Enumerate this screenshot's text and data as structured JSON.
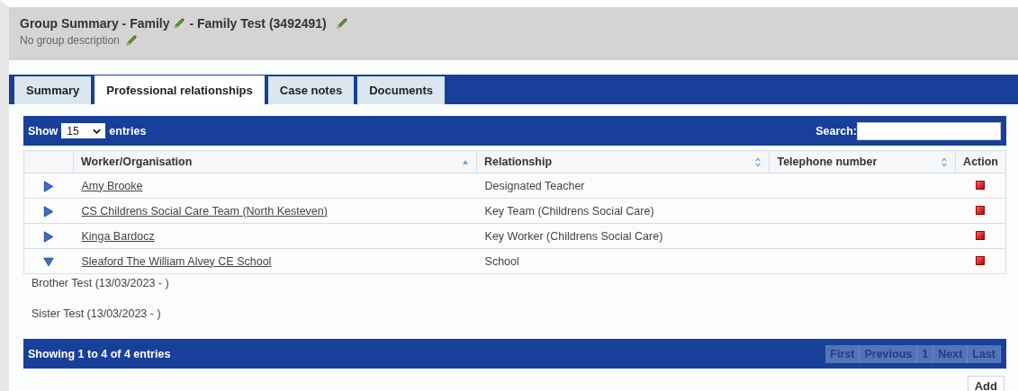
{
  "header": {
    "title_prefix": "Group Summary - Family",
    "title_suffix": "- Family Test (3492491)",
    "description": "No group description"
  },
  "tabs": [
    {
      "label": "Summary",
      "selected": false
    },
    {
      "label": "Professional relationships",
      "selected": true
    },
    {
      "label": "Case notes",
      "selected": false
    },
    {
      "label": "Documents",
      "selected": false
    }
  ],
  "length": {
    "show_label": "Show",
    "value": "15",
    "entries_label": "entries"
  },
  "search": {
    "label": "Search:"
  },
  "table": {
    "columns": [
      {
        "label": "Worker/Organisation",
        "sortable": true,
        "sorted": true
      },
      {
        "label": "Relationship",
        "sortable": true,
        "sorted": false
      },
      {
        "label": "Telephone number",
        "sortable": true,
        "sorted": false
      },
      {
        "label": "Action",
        "sortable": false,
        "sorted": false
      }
    ],
    "rows": [
      {
        "expanded": false,
        "worker": "Amy Brooke",
        "relationship": "Designated Teacher",
        "members": []
      },
      {
        "expanded": false,
        "worker": "CS Childrens Social Care Team (North Kesteven)",
        "relationship": "Key Team (Childrens Social Care)",
        "members": []
      },
      {
        "expanded": false,
        "worker": "Kinga Bardocz",
        "relationship": "Key Worker (Childrens Social Care)",
        "members": []
      },
      {
        "expanded": true,
        "worker": "Sleaford The William Alvey CE School",
        "relationship": "School",
        "members": [
          "Brother Test (13/03/2023 - )",
          "Sister Test (13/03/2023 - )"
        ]
      }
    ]
  },
  "info": "Showing 1 to 4 of 4 entries",
  "pagination": [
    {
      "label": "First",
      "disabled": true
    },
    {
      "label": "Previous",
      "disabled": true
    },
    {
      "label": "1",
      "disabled": true
    },
    {
      "label": "Next",
      "disabled": true
    },
    {
      "label": "Last",
      "disabled": true
    }
  ],
  "add_button": "Add"
}
